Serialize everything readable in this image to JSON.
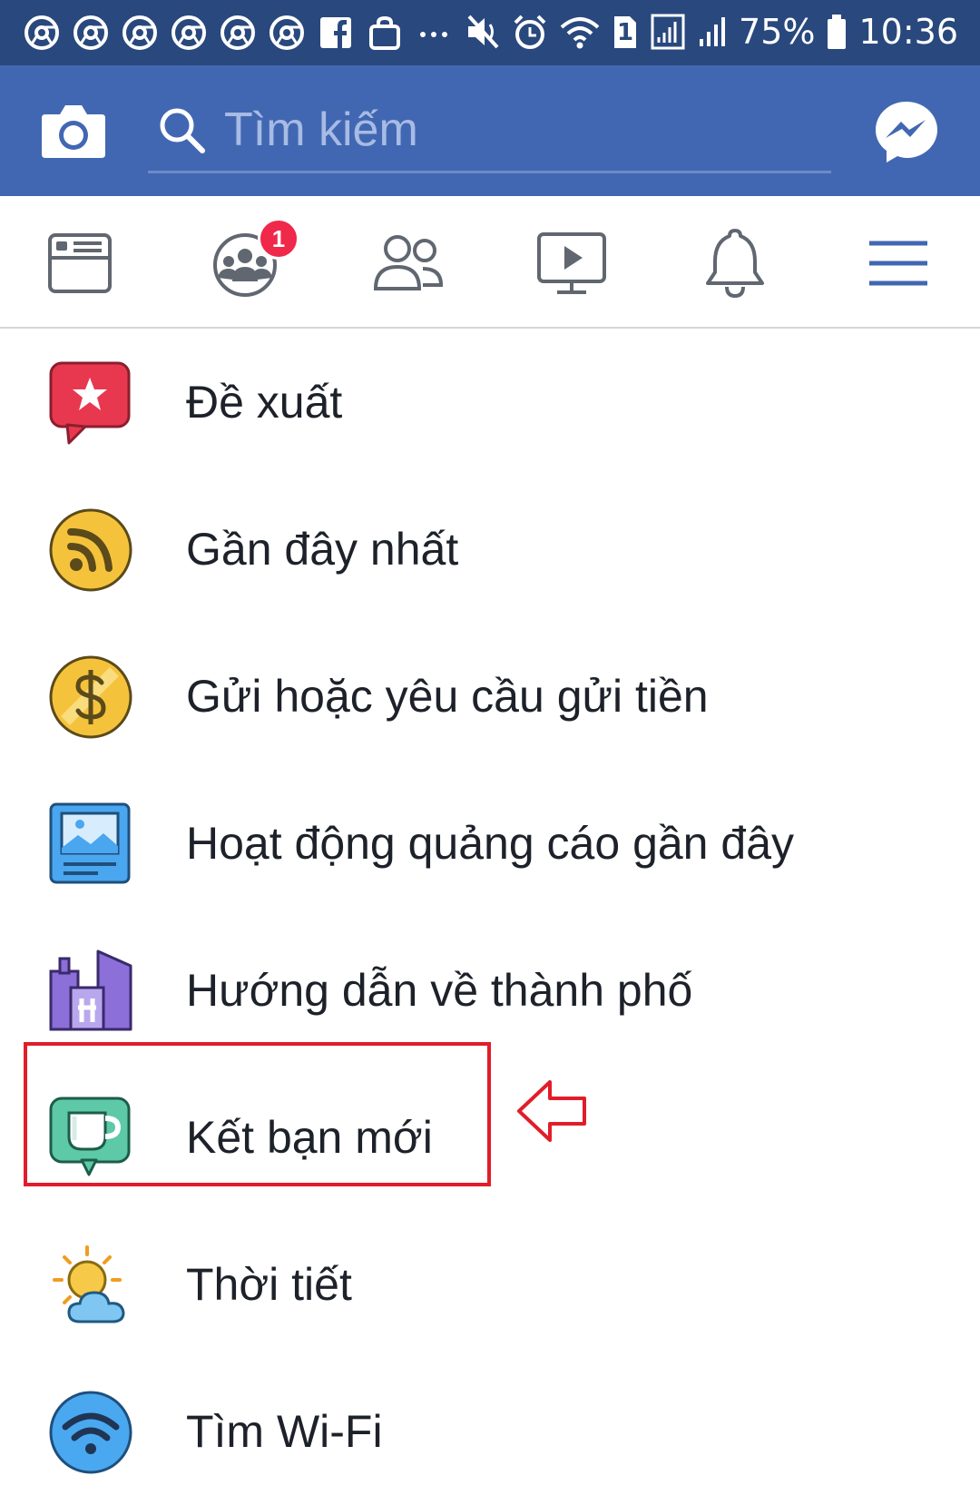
{
  "status_bar": {
    "battery": "75%",
    "time": "10:36",
    "sim_slot": "1",
    "left_icons": [
      "chrome-icon",
      "chrome-icon",
      "chrome-icon",
      "chrome-icon",
      "chrome-icon",
      "chrome-icon",
      "facebook-icon",
      "shopping-bag-icon",
      "more-dots-icon"
    ],
    "right_icons": [
      "mute-icon",
      "alarm-icon",
      "wifi-icon",
      "sim-icon",
      "signal-icon",
      "signal-icon",
      "battery-icon"
    ]
  },
  "header": {
    "search_placeholder": "Tìm kiếm",
    "colors": {
      "status_bar": "#29487d",
      "header": "#4267b2"
    }
  },
  "tabs": [
    {
      "name": "news-feed",
      "icon": "news-feed-icon"
    },
    {
      "name": "groups",
      "icon": "groups-icon",
      "badge": "1"
    },
    {
      "name": "friends",
      "icon": "friends-icon"
    },
    {
      "name": "watch",
      "icon": "watch-icon"
    },
    {
      "name": "notifications",
      "icon": "bell-icon"
    },
    {
      "name": "menu",
      "icon": "hamburger-menu-icon",
      "active": true
    }
  ],
  "menu": {
    "items": [
      {
        "label": "Đề xuất",
        "icon": "recommendation-star-icon"
      },
      {
        "label": "Gần đây nhất",
        "icon": "rss-feed-icon"
      },
      {
        "label": "Gửi hoặc yêu cầu gửi tiền",
        "icon": "dollar-coin-icon"
      },
      {
        "label": "Hoạt động quảng cáo gần đây",
        "icon": "ad-image-icon"
      },
      {
        "label": "Hướng dẫn về thành phố",
        "icon": "city-buildings-icon"
      },
      {
        "label": "Kết bạn mới",
        "icon": "coffee-cup-icon",
        "highlighted": true
      },
      {
        "label": "Thời tiết",
        "icon": "weather-sun-cloud-icon"
      },
      {
        "label": "Tìm Wi-Fi",
        "icon": "wifi-finder-icon"
      }
    ]
  },
  "annotation": {
    "color": "#e11d2a",
    "arrow_icon": "left-arrow-icon"
  }
}
